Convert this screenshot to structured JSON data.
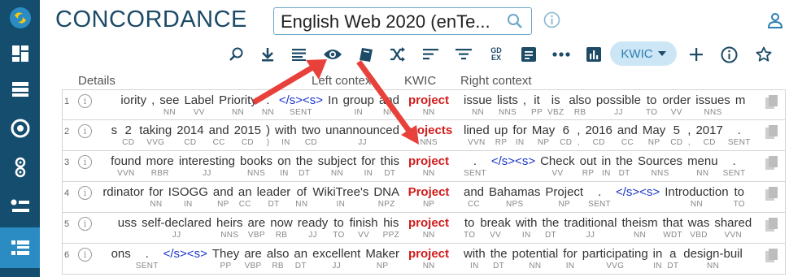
{
  "app": {
    "title": "CONCORDANCE"
  },
  "corpus": {
    "value": "English Web 2020 (enTe..."
  },
  "sidebar": {
    "items": [
      {
        "icon": "logo-icon"
      },
      {
        "icon": "dashboard-icon"
      },
      {
        "icon": "list-icon"
      },
      {
        "icon": "target-icon"
      },
      {
        "icon": "rings-icon"
      },
      {
        "icon": "bullet-list-icon"
      },
      {
        "icon": "concordance-icon",
        "active": true
      }
    ]
  },
  "toolbar": {
    "icons": [
      "search-zoom-icon",
      "download-icon",
      "lines-icon",
      "eye-icon",
      "book-icon",
      "shuffle-icon",
      "sort-icon",
      "filter-icon",
      "gdex-icon",
      "note-icon",
      "dots-icon",
      "chart-icon"
    ],
    "gdex_top": "GD",
    "gdex_bottom": "EX",
    "view_mode": "KWIC"
  },
  "columns": {
    "details": "Details",
    "left": "Left context",
    "kwic": "KWIC",
    "right": "Right context"
  },
  "colors": {
    "sidebar": "#154d6e",
    "sidebar_active": "#2b8cc4",
    "kwic": "#d11b1b",
    "tag": "#1a35c9",
    "arrow": "#e8413b"
  },
  "rows": [
    {
      "num": "1",
      "left": [
        [
          "iority",
          ""
        ],
        [
          ",",
          ""
        ],
        [
          "see",
          "NN"
        ],
        [
          "Label",
          "VV"
        ],
        [
          "Priority",
          "NN"
        ],
        [
          ".",
          "NN"
        ],
        [
          "</s><s>",
          "SENT"
        ],
        [
          "In",
          ""
        ],
        [
          "group",
          "IN"
        ],
        [
          "and",
          "NN"
        ]
      ],
      "kwic": [
        "project",
        "NN"
      ],
      "right": [
        [
          "issue",
          "NN"
        ],
        [
          "lists",
          "NNS"
        ],
        [
          ",",
          ""
        ],
        [
          "it",
          "PP"
        ],
        [
          "is",
          "VBZ"
        ],
        [
          "also",
          "RB"
        ],
        [
          "possible",
          "JJ"
        ],
        [
          "to",
          "TO"
        ],
        [
          "order",
          "VV"
        ],
        [
          "issues",
          "NNS"
        ],
        [
          "m",
          ""
        ]
      ]
    },
    {
      "num": "2",
      "left": [
        [
          "s",
          ""
        ],
        [
          "2",
          "CD"
        ],
        [
          "taking",
          "VVG"
        ],
        [
          "2014",
          "CD"
        ],
        [
          "and",
          "CC"
        ],
        [
          "2015",
          "CD"
        ],
        [
          ")",
          ")"
        ],
        [
          "with",
          "IN"
        ],
        [
          "two",
          "CD"
        ],
        [
          "unannounced",
          "JJ"
        ]
      ],
      "kwic": [
        "projects",
        "NNS"
      ],
      "right": [
        [
          "lined",
          "VVN"
        ],
        [
          "up",
          "RP"
        ],
        [
          "for",
          "IN"
        ],
        [
          "May",
          "NP"
        ],
        [
          "6",
          "CD"
        ],
        [
          ",",
          ","
        ],
        [
          "2016",
          "CD"
        ],
        [
          "and",
          "CC"
        ],
        [
          "May",
          "NP"
        ],
        [
          "5",
          "CD"
        ],
        [
          ",",
          ","
        ],
        [
          "2017",
          "CD"
        ],
        [
          ".",
          "SENT"
        ]
      ]
    },
    {
      "num": "3",
      "left": [
        [
          "found",
          "VVN"
        ],
        [
          "more",
          "RBR"
        ],
        [
          "interesting",
          "JJ"
        ],
        [
          "books",
          "NNS"
        ],
        [
          "on",
          "IN"
        ],
        [
          "the",
          "DT"
        ],
        [
          "subject",
          "NN"
        ],
        [
          "for",
          "IN"
        ],
        [
          "this",
          "DT"
        ]
      ],
      "kwic": [
        "project",
        "NN"
      ],
      "right": [
        [
          ".",
          "SENT"
        ],
        [
          "</s><s>",
          ""
        ],
        [
          "Check",
          "VV"
        ],
        [
          "out",
          "RP"
        ],
        [
          "in",
          "IN"
        ],
        [
          "the",
          "DT"
        ],
        [
          "Sources",
          "NNS"
        ],
        [
          "menu",
          "NN"
        ],
        [
          ".",
          "SENT"
        ]
      ]
    },
    {
      "num": "4",
      "left": [
        [
          "rdinator",
          ""
        ],
        [
          "for",
          "NN"
        ],
        [
          "ISOGG",
          "IN"
        ],
        [
          "and",
          "NP"
        ],
        [
          "an",
          "CC"
        ],
        [
          "leader",
          "DT"
        ],
        [
          "of",
          "NN"
        ],
        [
          "WikiTree's",
          "IN"
        ],
        [
          "DNA",
          "NPZ"
        ]
      ],
      "kwic": [
        "Project",
        "NP"
      ],
      "right": [
        [
          "and",
          "CC"
        ],
        [
          "Bahamas",
          "NPS"
        ],
        [
          "Project",
          "NP"
        ],
        [
          ".",
          "SENT"
        ],
        [
          "</s><s>",
          ""
        ],
        [
          "Introduction",
          "NN"
        ],
        [
          "to",
          "TO"
        ]
      ]
    },
    {
      "num": "5",
      "left": [
        [
          "uss",
          ""
        ],
        [
          "self-declared",
          "JJ"
        ],
        [
          "heirs",
          "NNS"
        ],
        [
          "are",
          "VBP"
        ],
        [
          "now",
          "RB"
        ],
        [
          "ready",
          "JJ"
        ],
        [
          "to",
          "TO"
        ],
        [
          "finish",
          "VV"
        ],
        [
          "his",
          "PPZ"
        ]
      ],
      "kwic": [
        "project",
        "NN"
      ],
      "right": [
        [
          "to",
          "TO"
        ],
        [
          "break",
          "VV"
        ],
        [
          "with",
          "IN"
        ],
        [
          "the",
          "DT"
        ],
        [
          "traditional",
          "JJ"
        ],
        [
          "theism",
          "NN"
        ],
        [
          "that",
          "WDT"
        ],
        [
          "was",
          "VBD"
        ],
        [
          "shared",
          "VVN"
        ]
      ]
    },
    {
      "num": "6",
      "left": [
        [
          "ons",
          ""
        ],
        [
          ".",
          "SENT"
        ],
        [
          "</s><s>",
          ""
        ],
        [
          "They",
          "PP"
        ],
        [
          "are",
          "VBP"
        ],
        [
          "also",
          "RB"
        ],
        [
          "an",
          "DT"
        ],
        [
          "excellent",
          "JJ"
        ],
        [
          "Maker",
          "NP"
        ]
      ],
      "kwic": [
        "project",
        "NN"
      ],
      "right": [
        [
          "with",
          "IN"
        ],
        [
          "the",
          "DT"
        ],
        [
          "potential",
          "NN"
        ],
        [
          "for",
          "IN"
        ],
        [
          "participating",
          "VVG"
        ],
        [
          "in",
          "IN"
        ],
        [
          "a",
          "DT"
        ],
        [
          "design-buil",
          "NN"
        ]
      ]
    }
  ]
}
